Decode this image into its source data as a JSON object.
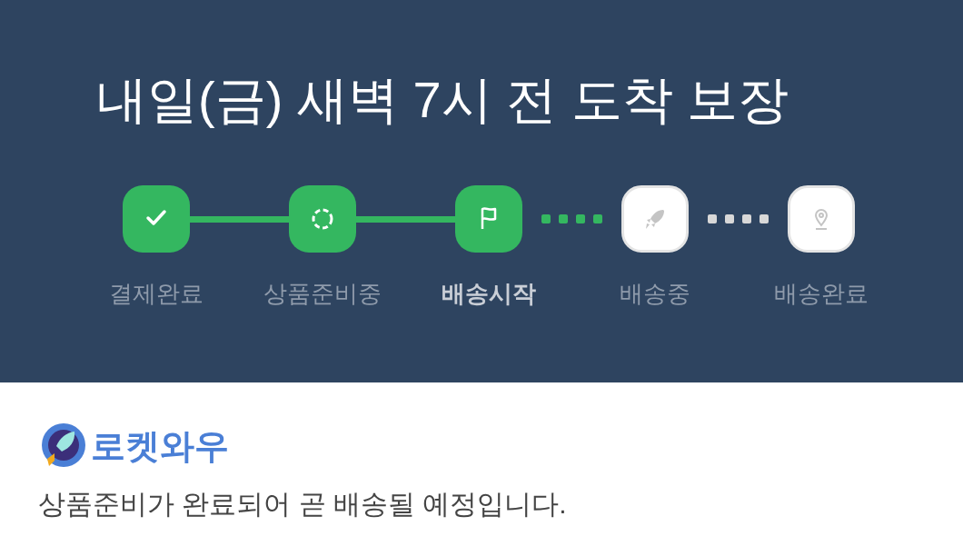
{
  "title": "내일(금) 새벽 7시 전 도착 보장",
  "steps": [
    {
      "label": "결제완료",
      "kind": "check",
      "reached": true,
      "selected": false
    },
    {
      "label": "상품준비중",
      "kind": "spinner",
      "reached": true,
      "selected": false
    },
    {
      "label": "배송시작",
      "kind": "flag",
      "reached": true,
      "selected": true
    },
    {
      "label": "배송중",
      "kind": "rocket",
      "reached": false,
      "selected": false
    },
    {
      "label": "배송완료",
      "kind": "pin",
      "reached": false,
      "selected": false
    }
  ],
  "brand": "로켓와우",
  "message": "상품준비가 완료되어 곧 배송될 예정입니다."
}
